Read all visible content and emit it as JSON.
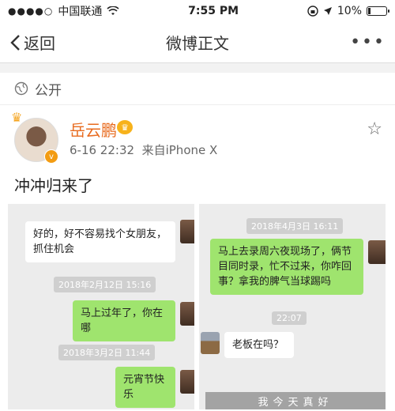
{
  "statusbar": {
    "signal_dots": "●●●●○",
    "carrier": "中国联通",
    "wifi_icon": "wifi-icon",
    "time": "7:55 PM",
    "battery": "10%"
  },
  "navbar": {
    "back_label": "返回",
    "title": "微博正文",
    "more_label": "•••"
  },
  "privacy": {
    "label": "公开"
  },
  "post": {
    "author": "岳云鹏",
    "date": "6-16 22:32",
    "source": "来自iPhone X",
    "vbadge": "v",
    "text": "冲冲归来了"
  },
  "images": {
    "left": {
      "bubble1": "好的，好不容易找个女朋友，抓住机会",
      "time1": "2018年2月12日 15:16",
      "bubble2": "马上过年了，你在哪",
      "time2": "2018年3月2日 11:44",
      "bubble3": "元宵节快乐"
    },
    "right": {
      "time1": "2018年4月3日 16:11",
      "bubble1": "马上去录周六夜现场了，俩节目同时录，忙不过来，你咋回事？拿我的脾气当球踢吗",
      "time2": "22:07",
      "bubble2": "老板在吗？"
    },
    "watermark": "我今天真好"
  }
}
